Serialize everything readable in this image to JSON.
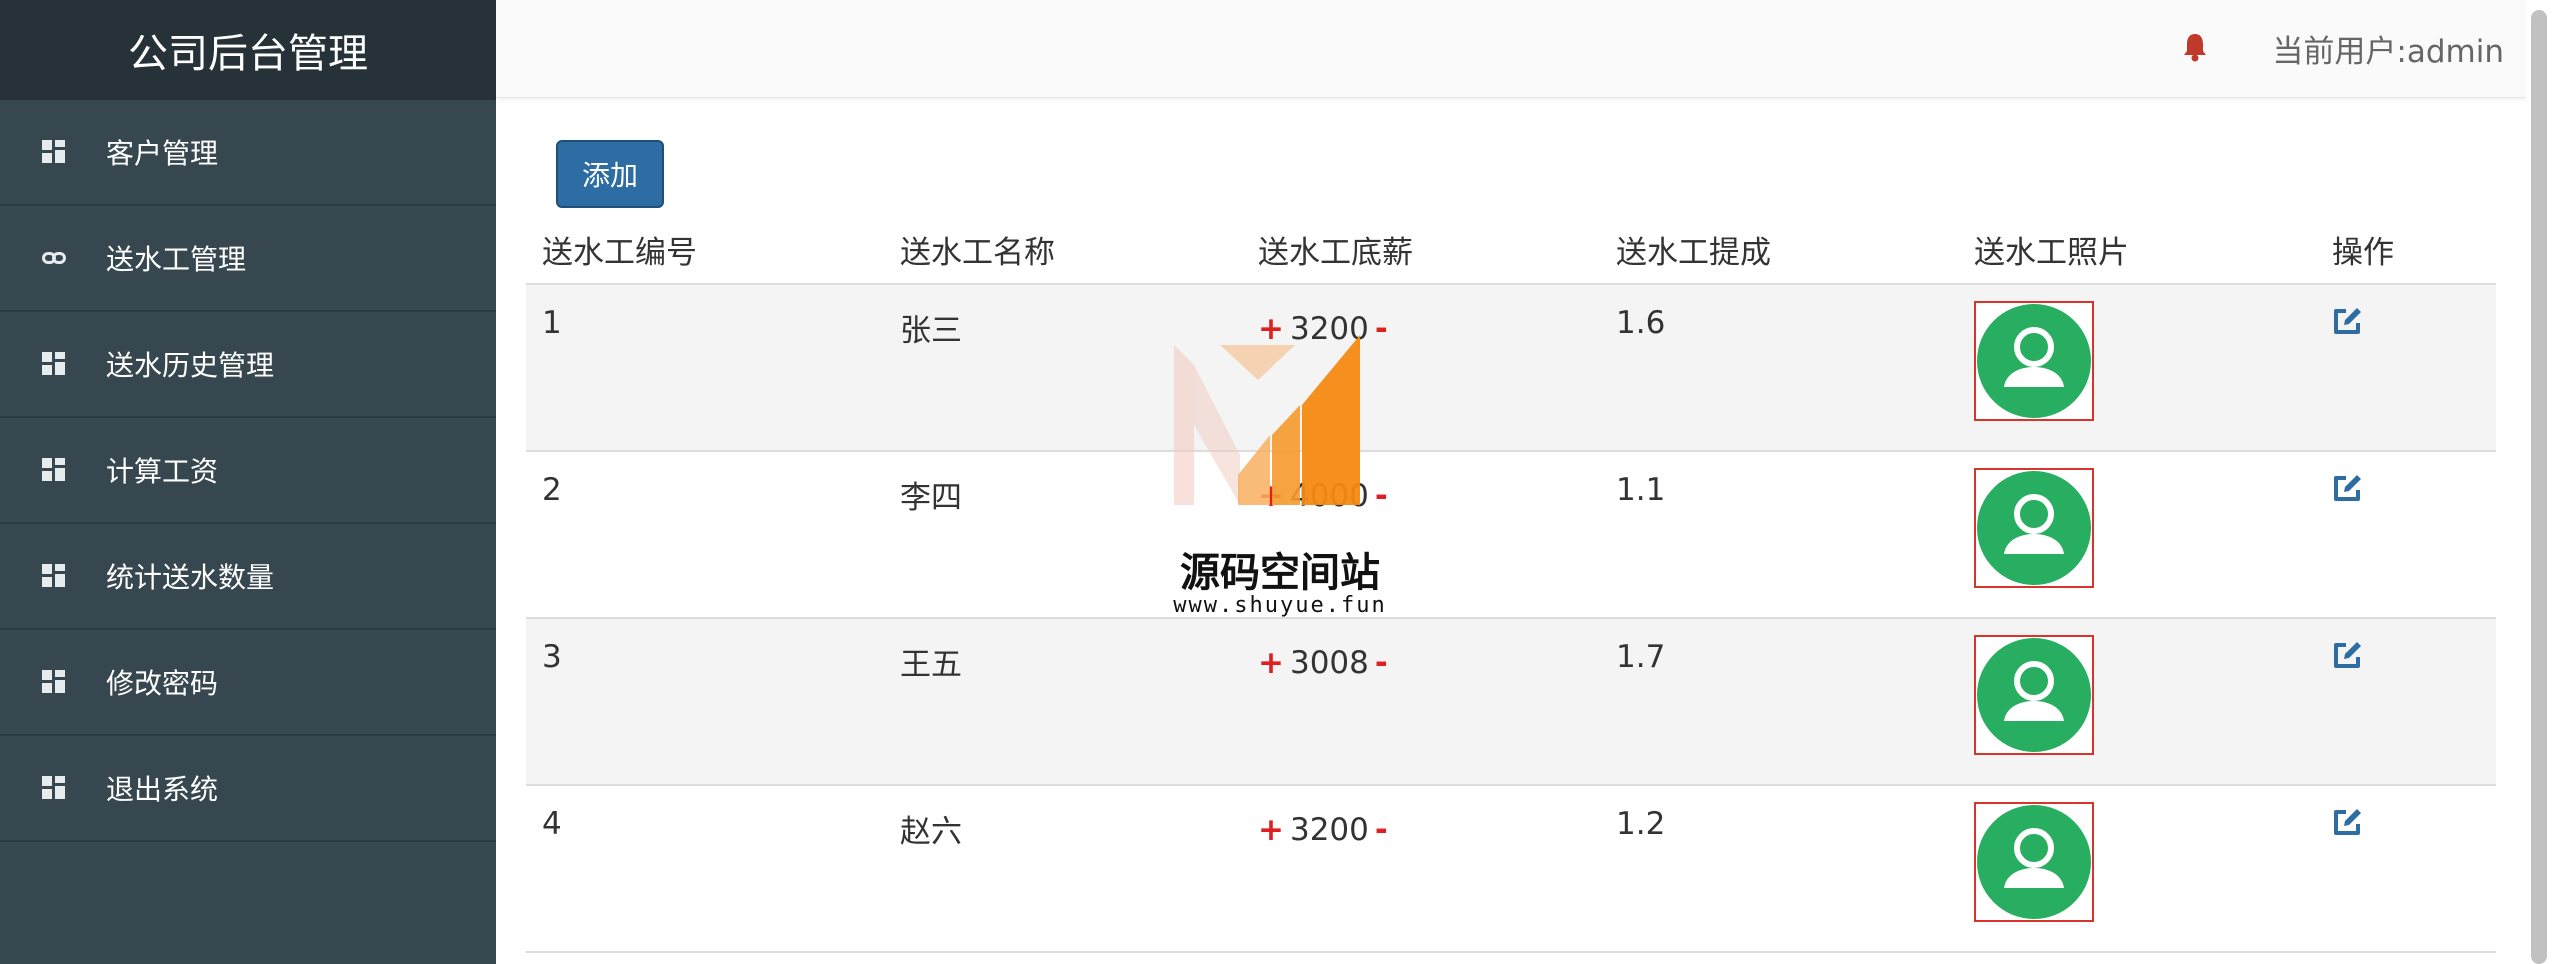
{
  "sidebar": {
    "title": "公司后台管理",
    "items": [
      {
        "label": "客户管理",
        "icon": "dashboard-grid-icon"
      },
      {
        "label": "送水工管理",
        "icon": "link-icon"
      },
      {
        "label": "送水历史管理",
        "icon": "dashboard-grid-icon"
      },
      {
        "label": "计算工资",
        "icon": "dashboard-grid-icon"
      },
      {
        "label": "统计送水数量",
        "icon": "dashboard-grid-icon"
      },
      {
        "label": "修改密码",
        "icon": "dashboard-grid-icon"
      },
      {
        "label": "退出系统",
        "icon": "dashboard-grid-icon"
      }
    ]
  },
  "header": {
    "current_user": "当前用户:admin",
    "bell_icon": "bell-icon",
    "bell_color": "#c0392b"
  },
  "toolbar": {
    "add_label": "添加"
  },
  "table": {
    "columns": [
      "送水工编号",
      "送水工名称",
      "送水工底薪",
      "送水工提成",
      "送水工照片",
      "操作"
    ],
    "rows": [
      {
        "id": "1",
        "name": "张三",
        "salary": "3200",
        "commission": "1.6"
      },
      {
        "id": "2",
        "name": "李四",
        "salary": "4000",
        "commission": "1.1"
      },
      {
        "id": "3",
        "name": "王五",
        "salary": "3008",
        "commission": "1.7"
      },
      {
        "id": "4",
        "name": "赵六",
        "salary": "3200",
        "commission": "1.2"
      }
    ],
    "plus_symbol": "+",
    "minus_symbol": "-"
  },
  "watermark": {
    "title": "源码空间站",
    "url": "www.shuyue.fun"
  },
  "colors": {
    "sidebar_bg": "#37474f",
    "brand_bg": "#263238",
    "primary_button": "#2e6da4",
    "avatar_green": "#27ae60",
    "photo_border": "#d9342b",
    "adjust_red": "#e02020",
    "edit_blue": "#2e6da4"
  }
}
